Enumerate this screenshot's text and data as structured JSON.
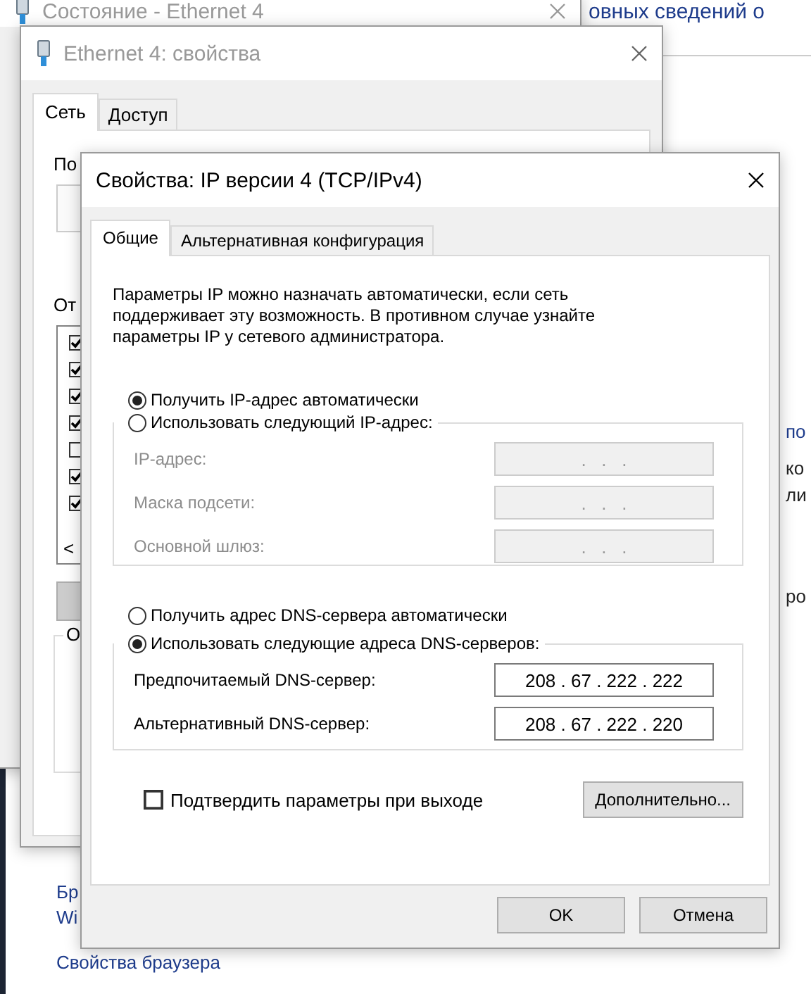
{
  "background_window": {
    "heading": "овных сведений о",
    "right_texts": [
      {
        "text": "по",
        "kind": "link"
      },
      {
        "text": "ко",
        "kind": "plain"
      },
      {
        "text": "ли",
        "kind": "plain"
      },
      {
        "text": "ро",
        "kind": "plain"
      }
    ],
    "left_texts": [
      {
        "text": "Бр",
        "kind": "link"
      },
      {
        "text": "Wi",
        "kind": "link"
      },
      {
        "text": "Свойства браузера",
        "kind": "link"
      }
    ]
  },
  "status_window": {
    "title": "Состояние - Ethernet 4"
  },
  "properties_window": {
    "title": "Ethernet 4: свойства",
    "tabs": [
      {
        "label": "Сеть",
        "selected": true
      },
      {
        "label": "Доступ",
        "selected": false
      }
    ],
    "connect_label": "По",
    "components_label": "От",
    "components": [
      {
        "checked": true
      },
      {
        "checked": true
      },
      {
        "checked": true
      },
      {
        "checked": true
      },
      {
        "checked": false
      },
      {
        "checked": true
      },
      {
        "checked": true
      }
    ],
    "scroll_arrow": "<",
    "group_label": "О"
  },
  "ipv4_dialog": {
    "title": "Свойства: IP версии 4 (TCP/IPv4)",
    "tabs": [
      {
        "label": "Общие",
        "selected": true
      },
      {
        "label": "Альтернативная конфигурация",
        "selected": false
      }
    ],
    "description": "Параметры IP можно назначать автоматически, если сеть поддерживает эту возможность. В противном случае узнайте параметры IP у сетевого администратора.",
    "ip_auto": {
      "label": "Получить IP-адрес автоматически",
      "selected": true
    },
    "ip_manual": {
      "label": "Использовать следующий IP-адрес:",
      "selected": false,
      "fields": [
        {
          "label": "IP-адрес:",
          "value": ".   .   .",
          "disabled": true
        },
        {
          "label": "Маска подсети:",
          "value": ".   .   .",
          "disabled": true
        },
        {
          "label": "Основной шлюз:",
          "value": ".   .   .",
          "disabled": true
        }
      ]
    },
    "dns_auto": {
      "label": "Получить адрес DNS-сервера автоматически",
      "selected": false
    },
    "dns_manual": {
      "label": "Использовать следующие адреса DNS-серверов:",
      "selected": true,
      "fields": [
        {
          "label": "Предпочитаемый DNS-сервер:",
          "value": "208 . 67 . 222 . 222",
          "disabled": false
        },
        {
          "label": "Альтернативный DNS-сервер:",
          "value": "208 . 67 . 222 . 220",
          "disabled": false
        }
      ]
    },
    "validate": {
      "label": "Подтвердить параметры при выходе",
      "checked": false
    },
    "advanced_button": "Дополнительно...",
    "ok_button": "OK",
    "cancel_button": "Отмена"
  }
}
